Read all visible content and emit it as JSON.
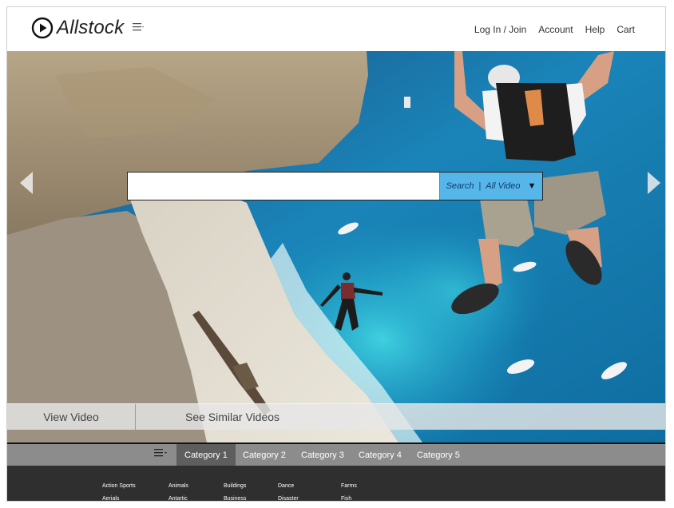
{
  "header": {
    "logo_text": "Allstock",
    "nav": [
      "Log In / Join",
      "Account",
      "Help",
      "Cart"
    ]
  },
  "search": {
    "value": "",
    "button_label": "Search",
    "separator": "|",
    "scope": "All Video",
    "dropdown_glyph": "▼"
  },
  "hero_actions": {
    "view": "View Video",
    "similar": "See Similar Videos"
  },
  "categories": [
    "Category 1",
    "Category 2",
    "Category 3",
    "Category 4",
    "Category 5"
  ],
  "active_category": "Category 1",
  "subcategories": [
    [
      "Action Sports",
      "Aerials"
    ],
    [
      "Animals",
      "Antartic"
    ],
    [
      "Buildings",
      "Business"
    ],
    [
      "Dance",
      "Disaster"
    ],
    [
      "Farms",
      "Fish"
    ]
  ],
  "colors": {
    "search_button": "#56b6ea",
    "category_bar": "#8c8c8c",
    "category_active": "#5e5e5e",
    "sub_panel": "#2f2f2f"
  },
  "icons": {
    "logo": "play-circle-icon",
    "menu": "hamburger-menu-icon",
    "prev": "chevron-left-icon",
    "next": "chevron-right-icon"
  }
}
